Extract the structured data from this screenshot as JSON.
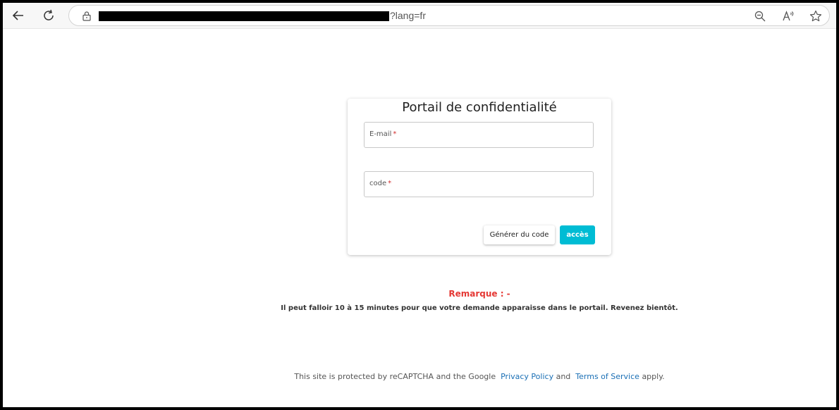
{
  "browser": {
    "url_suffix": "?lang=fr",
    "icons": [
      "back-icon",
      "refresh-icon",
      "lock-icon",
      "zoom-out-icon",
      "read-aloud-icon",
      "favorite-star-icon"
    ]
  },
  "card": {
    "title": "Portail de confidentialité",
    "email_label": "E-mail",
    "code_label": "code",
    "required_mark": "*",
    "generate_button": "Générer du code",
    "access_button": "accès"
  },
  "note": {
    "title": "Remarque : -",
    "text": "Il peut falloir 10 à 15 minutes pour que votre demande apparaisse dans le portail. Revenez bientôt."
  },
  "footer": {
    "prefix": "This site is protected by reCAPTCHA and the Google",
    "privacy_link": "Privacy Policy",
    "and": "and",
    "terms_link": "Terms of Service",
    "suffix": "apply."
  },
  "colors": {
    "accent": "#00bcd4",
    "note_red": "#e53935",
    "link": "#1a6fb5"
  }
}
